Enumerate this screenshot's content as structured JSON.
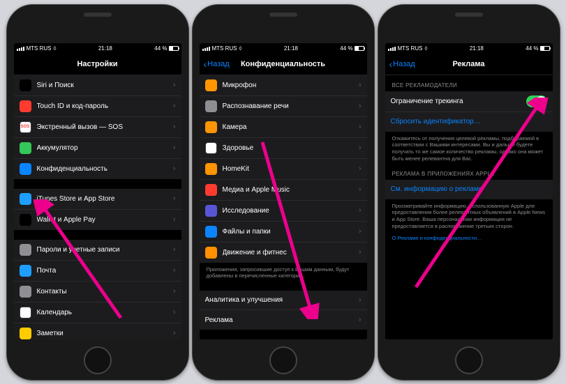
{
  "status": {
    "carrier": "MTS RUS",
    "time": "21:18",
    "battery": "44 %"
  },
  "phone1": {
    "title": "Настройки",
    "rows1": [
      {
        "label": "Siri и Поиск",
        "icon": "#000000",
        "name": "siri"
      },
      {
        "label": "Touch ID и код-пароль",
        "icon": "#ff3b30",
        "name": "touch-id"
      },
      {
        "label": "Экстренный вызов — SOS",
        "icon": "#ffffff",
        "name": "sos",
        "text": "SOS",
        "textcolor": "#ff3b30"
      },
      {
        "label": "Аккумулятор",
        "icon": "#34c759",
        "name": "battery"
      },
      {
        "label": "Конфиденциальность",
        "icon": "#0a84ff",
        "name": "privacy"
      }
    ],
    "rows2": [
      {
        "label": "iTunes Store и App Store",
        "icon": "#1e9fff",
        "name": "itunes"
      },
      {
        "label": "Wallet и Apple Pay",
        "icon": "#000000",
        "name": "wallet"
      }
    ],
    "rows3": [
      {
        "label": "Пароли и учетные записи",
        "icon": "#8e8e93",
        "name": "passwords"
      },
      {
        "label": "Почта",
        "icon": "#1e9fff",
        "name": "mail"
      },
      {
        "label": "Контакты",
        "icon": "#8e8e93",
        "name": "contacts"
      },
      {
        "label": "Календарь",
        "icon": "#ffffff",
        "name": "calendar"
      },
      {
        "label": "Заметки",
        "icon": "#ffcc00",
        "name": "notes"
      }
    ]
  },
  "phone2": {
    "back": "Назад",
    "title": "Конфиденциальность",
    "rows1": [
      {
        "label": "Микрофон",
        "icon": "#ff9500",
        "name": "microphone"
      },
      {
        "label": "Распознавание речи",
        "icon": "#8e8e93",
        "name": "speech"
      },
      {
        "label": "Камера",
        "icon": "#ff9500",
        "name": "camera"
      },
      {
        "label": "Здоровье",
        "icon": "#ffffff",
        "name": "health"
      },
      {
        "label": "HomeKit",
        "icon": "#ff9500",
        "name": "homekit"
      },
      {
        "label": "Медиа и Apple Music",
        "icon": "#ff3b30",
        "name": "media"
      },
      {
        "label": "Исследование",
        "icon": "#5856d6",
        "name": "research"
      },
      {
        "label": "Файлы и папки",
        "icon": "#0a84ff",
        "name": "files"
      },
      {
        "label": "Движение и фитнес",
        "icon": "#ff9100",
        "name": "motion"
      }
    ],
    "footer1": "Приложения, запросившие доступ к Вашим данным, будут добавлены в перечисленные категории.",
    "rows2": [
      {
        "label": "Аналитика и улучшения",
        "name": "analytics"
      },
      {
        "label": "Реклама",
        "name": "advertising"
      }
    ]
  },
  "phone3": {
    "back": "Назад",
    "title": "Реклама",
    "sect1": "ВСЕ РЕКЛАМОДАТЕЛИ",
    "toggleLabel": "Ограничение трекинга",
    "resetLabel": "Сбросить идентификатор…",
    "footer1": "Откажитесь от получения целевой рекламы, подбираемой в соответствии с Вашими интересами. Вы и дальше будете получать то же самое количество рекламы, однако она может быть менее релевантна для Вас.",
    "sect2": "РЕКЛАМА В ПРИЛОЖЕНИЯХ APPLE",
    "infoLabel": "См. информацию о рекламе",
    "footer2": "Просматривайте информацию, использованную Apple для предоставления более релевантных объявлений в Apple News и App Store. Ваша персональная информация не предоставляется в распоряжение третьих сторон.",
    "link": "О Рекламе и конфиденциальности…"
  }
}
